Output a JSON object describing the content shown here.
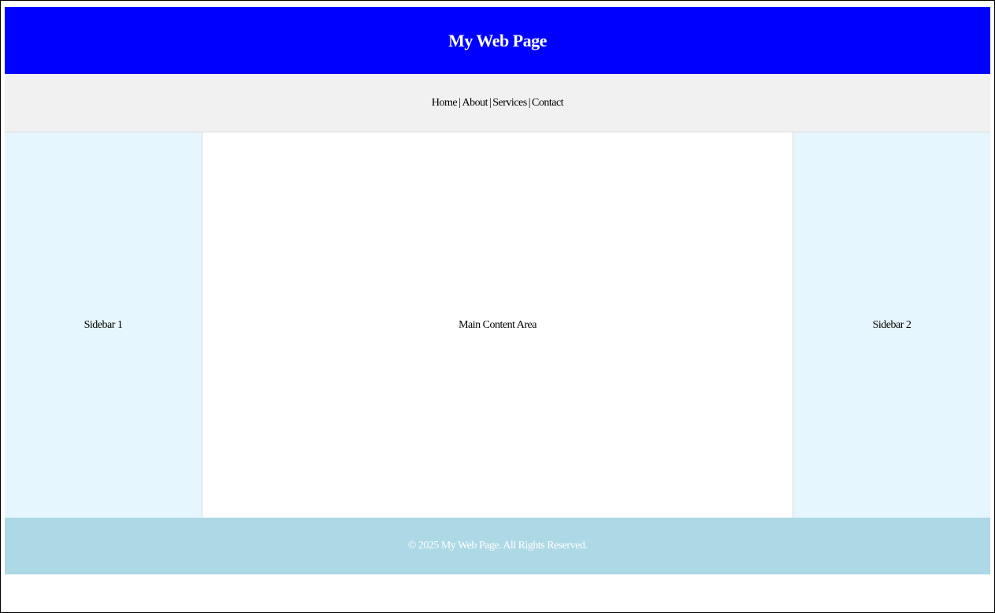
{
  "header": {
    "title": "My Web Page"
  },
  "nav": {
    "items": [
      {
        "label": "Home"
      },
      {
        "label": "About"
      },
      {
        "label": "Services"
      },
      {
        "label": "Contact"
      }
    ],
    "separator": "|"
  },
  "sidebars": {
    "left": {
      "label": "Sidebar 1"
    },
    "right": {
      "label": "Sidebar 2"
    }
  },
  "main": {
    "label": "Main Content Area"
  },
  "footer": {
    "text": "© 2025 My Web Page. All Rights Reserved."
  },
  "colors": {
    "header_bg": "#0000ff",
    "nav_bg": "#f1f1f1",
    "sidebar_bg": "#e6f6fe",
    "main_bg": "#ffffff",
    "footer_bg": "#add8e6"
  }
}
